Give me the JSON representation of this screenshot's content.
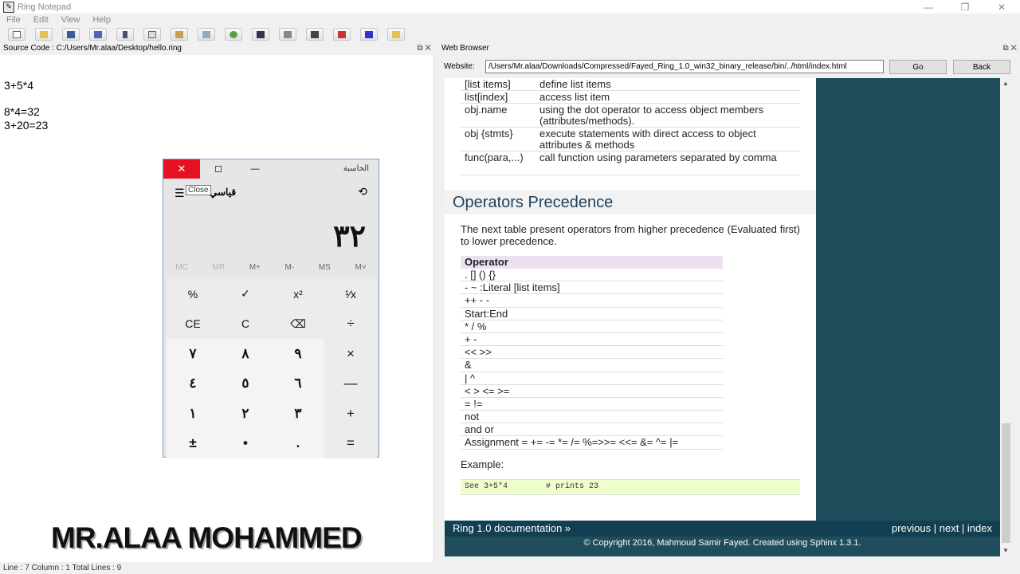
{
  "window": {
    "title": "Ring Notepad",
    "controls": [
      "—",
      "❐",
      "✕"
    ]
  },
  "menu": [
    "File",
    "Edit",
    "View",
    "Help"
  ],
  "toolbar_icons": [
    "new-file-icon",
    "open-folder-icon",
    "save-icon",
    "save-as-icon",
    "cut-icon",
    "copy-icon",
    "paste-icon",
    "font-icon",
    "color-icon",
    "tab-icon",
    "print-icon",
    "debug-icon",
    "run-icon",
    "run-gui-icon",
    "open-folder-icon"
  ],
  "source": {
    "header": "Source Code : C:/Users/Mr.alaa/Desktop/hello.ring",
    "pane_controls": "⧉ ✕",
    "lines": [
      "3+5*4",
      "8*4=32",
      "3+20=23"
    ],
    "status": "Line : 7 Column : 1 Total Lines : 9"
  },
  "watermark": "MR.ALAA MOHAMMED",
  "calculator": {
    "title": "الحاسبة",
    "close": "✕",
    "max": "☐",
    "min": "—",
    "tooltip": "Close",
    "menu_icon": "☰",
    "mode": "قياسي",
    "history_icon": "⟲",
    "display": "٣٢",
    "memory": [
      "MC",
      "MR",
      "M+",
      "M-",
      "MS",
      "M˅"
    ],
    "keys": [
      "%",
      "✓",
      "x²",
      "¹⁄x",
      "CE",
      "C",
      "⌫",
      "÷",
      "٧",
      "٨",
      "٩",
      "×",
      "٤",
      "٥",
      "٦",
      "—",
      "١",
      "٢",
      "٣",
      "+",
      "±",
      "•",
      ".",
      "="
    ]
  },
  "browser": {
    "header": "Web Browser",
    "pane_controls": "⧉ ✕",
    "address_label": "Website:",
    "url": "/Users/Mr.alaa/Downloads/Compressed/Fayed_Ring_1.0_win32_binary_release/bin/../html/index.html",
    "go": "Go",
    "back": "Back",
    "list_rows": [
      {
        "op": "[list items]",
        "desc": "define list items"
      },
      {
        "op": "list[index]",
        "desc": "access list item"
      },
      {
        "op": "obj.name",
        "desc": "using the dot operator to access object members (attributes/methods)."
      },
      {
        "op": "obj {stmts}",
        "desc": "execute statements with direct access to object attributes & methods"
      },
      {
        "op": "func(para,...)",
        "desc": "call function using parameters separated by comma"
      }
    ],
    "section_title": "Operators Precedence",
    "paragraph": "The next table present operators from higher precedence (Evaluated first) to lower precedence.",
    "precedence_header": "Operator",
    "precedence": [
      ". [] () {}",
      "- ~ :Literal [list items]",
      "++ - -",
      "Start:End",
      "* / %",
      "+ -",
      "<< >>",
      "&",
      "| ^",
      "< > <= >=",
      "= !=",
      "not",
      "and or",
      "Assignment = += -= *= /= %=>>= <<= &= ^= |="
    ],
    "example_label": "Example:",
    "example_code": "See 3+5*4        # prints 23",
    "relbar_left": "Ring 1.0 documentation »",
    "relbar_right": "previous | next | index",
    "footer": "© Copyright 2016, Mahmoud Samir Fayed. Created using Sphinx 1.3.1."
  }
}
